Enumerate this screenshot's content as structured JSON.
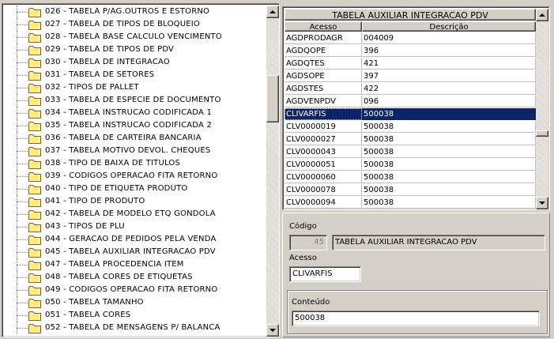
{
  "tree": {
    "items": [
      "026 - TABELA P/AG.OUTROS E ESTORNO",
      "027 - TABELA DE TIPOS DE BLOQUEIO",
      "028 - TABELA BASE CALCULO VENCIMENTO",
      "029 - TABELA DE TIPOS DE PDV",
      "030 - TABELA DE INTEGRACAO",
      "031 - TABELA DE SETORES",
      "032 - TIPOS DE PALLET",
      "033 - TABELA DE ESPECIE DE DOCUMENTO",
      "034 - TABELA INSTRUCAO CODIFICADA 1",
      "035 - TABELA INSTRUCAO CODIFICADA 2",
      "036 - TABELA DE CARTEIRA BANCARIA",
      "037 - TABELA MOTIVO DEVOL. CHEQUES",
      "038 - TIPO DE BAIXA DE TITULOS",
      "039 - CODIGOS OPERACAO FITA RETORNO",
      "040 - TIPO DE ETIQUETA PRODUTO",
      "041 - TIPO DE PRODUTO",
      "042 - TABELA DE MODELO ETQ GONDOLA",
      "043 - TIPOS DE PLU",
      "044 - GERACAO DE PEDIDOS PELA VENDA",
      "045 - TABELA AUXILIAR INTEGRACAO PDV",
      "047 - TABELA PROCEDENCIA ITEM",
      "048 - TABELA CORES DE ETIQUETAS",
      "049 - CODIGOS OPERACAO FITA RETORNO",
      "050 - TABELA TAMANHO",
      "051 - TABELA CORES",
      "052 - TABELA DE MENSAGENS P/ BALANCA"
    ]
  },
  "grid": {
    "title": "TABELA AUXILIAR INTEGRACAO PDV",
    "col_acesso": "Acesso",
    "col_descricao": "Descrição",
    "rows": [
      {
        "acesso": "AGDPRODAGR",
        "descricao": "004009"
      },
      {
        "acesso": "AGDQOPE",
        "descricao": "396"
      },
      {
        "acesso": "AGDQTES",
        "descricao": "421"
      },
      {
        "acesso": "AGDSOPE",
        "descricao": "397"
      },
      {
        "acesso": "AGDSTES",
        "descricao": "422"
      },
      {
        "acesso": "AGDVENPDV",
        "descricao": "096"
      },
      {
        "acesso": "CLIVARFIS",
        "descricao": "500038"
      },
      {
        "acesso": "CLV0000019",
        "descricao": "500038"
      },
      {
        "acesso": "CLV0000027",
        "descricao": "500038"
      },
      {
        "acesso": "CLV0000043",
        "descricao": "500038"
      },
      {
        "acesso": "CLV0000051",
        "descricao": "500038"
      },
      {
        "acesso": "CLV0000060",
        "descricao": "500038"
      },
      {
        "acesso": "CLV0000078",
        "descricao": "500038"
      },
      {
        "acesso": "CLV0000094",
        "descricao": "500038"
      }
    ],
    "selected_index": 6
  },
  "detail": {
    "codigo_label": "Código",
    "codigo_value": "45",
    "codigo_desc": "TABELA AUXILIAR INTEGRACAO PDV",
    "acesso_label": "Acesso",
    "acesso_value": "CLIVARFIS",
    "conteudo_label": "Conteúdo",
    "conteudo_value": "500038"
  },
  "colors": {
    "selection": "#0a246a",
    "face": "#d4d0c8",
    "folder": "#ffe98a"
  }
}
